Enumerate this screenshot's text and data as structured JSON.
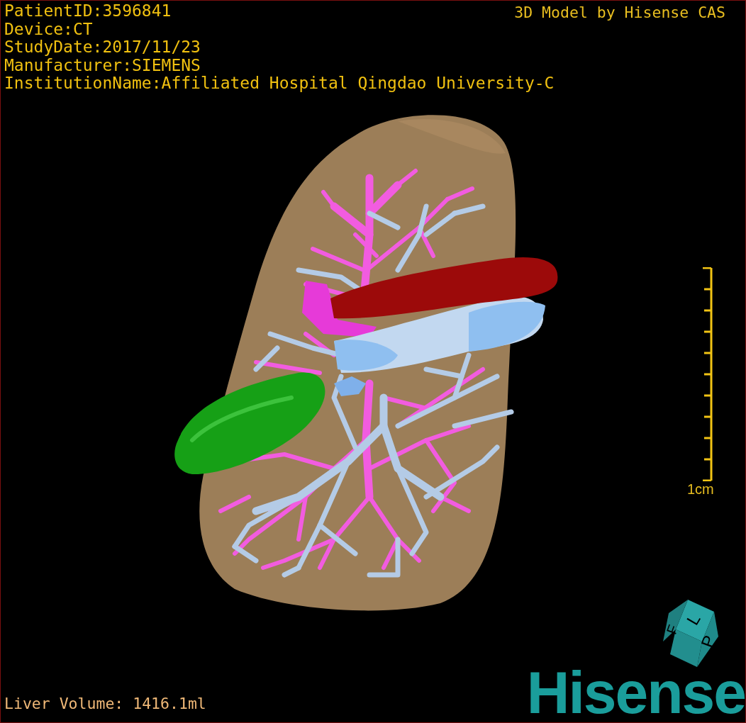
{
  "patient_info": [
    "PatientID:3596841",
    "Device:CT",
    "StudyDate:2017/11/23",
    "Manufacturer:SIEMENS",
    "InstitutionName:Affiliated Hospital Qingdao University-C"
  ],
  "title": "3D Model by Hisense CAS",
  "scale_bar": {
    "label": "1cm"
  },
  "orientation_cube": {
    "faces": [
      "L",
      "P",
      "F"
    ]
  },
  "liver_volume": "Liver Volume: 1416.1ml",
  "logo": "Hisense"
}
